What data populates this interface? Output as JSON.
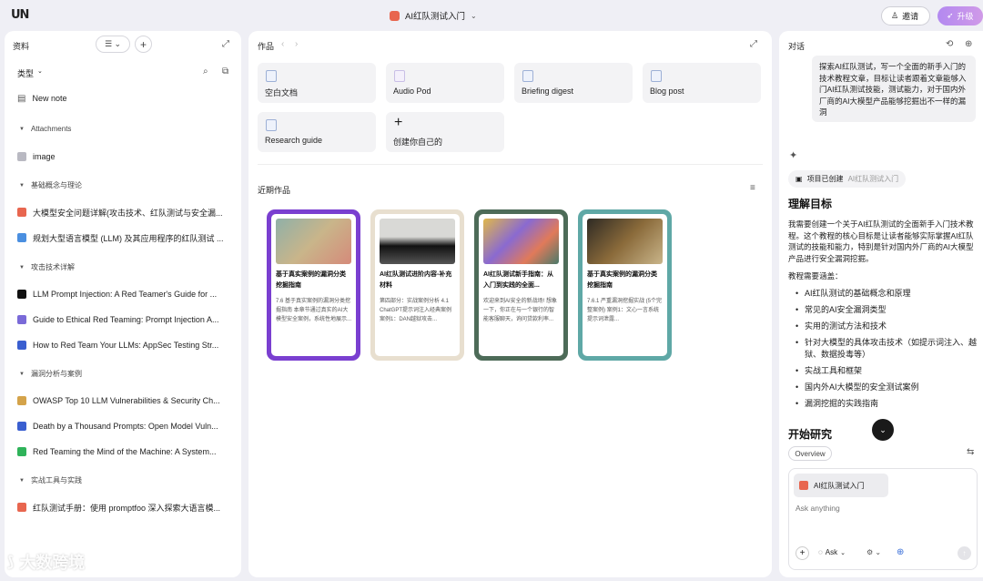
{
  "topbar": {
    "logo": "UN",
    "project_title": "AI红队测试入门",
    "invite_label": "邀请",
    "upgrade_label": "升级"
  },
  "left": {
    "title": "资料",
    "type_filter": "类型",
    "new_note": "New note",
    "groups": [
      {
        "label": "Attachments",
        "items": [
          {
            "label": "image",
            "color": "#b9b9c2"
          }
        ]
      },
      {
        "label": "基础概念与理论",
        "items": [
          {
            "label": "大模型安全问题详解(攻击技术、红队测试与安全漏...",
            "color": "#e8664f"
          },
          {
            "label": "规划大型语言模型 (LLM) 及其应用程序的红队测试 ...",
            "color": "#4a8fe0"
          }
        ]
      },
      {
        "label": "攻击技术详解",
        "items": [
          {
            "label": "LLM Prompt Injection: A Red Teamer's Guide for ...",
            "color": "#111111"
          },
          {
            "label": "Guide to Ethical Red Teaming: Prompt Injection A...",
            "color": "#7a6ad8"
          },
          {
            "label": "How to Red Team Your LLMs: AppSec Testing Str...",
            "color": "#3a5fd0"
          }
        ]
      },
      {
        "label": "漏洞分析与案例",
        "items": [
          {
            "label": "OWASP Top 10 LLM Vulnerabilities & Security Ch...",
            "color": "#d4a34a"
          },
          {
            "label": "Death by a Thousand Prompts: Open Model Vuln...",
            "color": "#3a5fd0"
          },
          {
            "label": "Red Teaming the Mind of the Machine: A System...",
            "color": "#2fb35a"
          }
        ]
      },
      {
        "label": "实战工具与实践",
        "items": [
          {
            "label": "红队测试手册：使用 promptfoo 深入探索大语言模...",
            "color": "#e8664f"
          }
        ]
      }
    ]
  },
  "middle": {
    "title": "作品",
    "templates": [
      "空白文档",
      "Audio Pod",
      "Briefing digest",
      "Blog post",
      "Research guide",
      "创建你自己的"
    ],
    "recent_title": "近期作品",
    "works": [
      {
        "title": "基于真实案例的漏洞分类挖掘指南",
        "desc": "7.6 基于真实案例的漏洞分类挖掘指南 本章节通过真实的AI大模型安全案例，系统性地展示...",
        "frame": "#7a3fd0"
      },
      {
        "title": "AI红队测试进阶内容-补充材料",
        "desc": "第四部分：实战案例分析 4.1 ChatGPT提示词注入经典案例 案例1：DAN越狱攻击...",
        "frame": "#e8dfcf"
      },
      {
        "title": "AI红队测试新手指南：从入门到实践的全面...",
        "desc": "欢迎来到AI安全的新战场! 想象一下，你正在与一个银行的智能客服聊天，询问贷款利率...",
        "frame": "#4d6b58"
      },
      {
        "title": "基于真实案例的漏洞分类挖掘指南",
        "desc": "7.6.1 严重漏洞挖掘实战 (5个完整案例) 案例1：文心一言系统提示词泄露...",
        "frame": "#5fa8a6"
      }
    ]
  },
  "right": {
    "title": "对话",
    "user_msg": "探索AI红队测试，写一个全面的新手入门的技术教程文章，目标让读者跟着文章能够入门AI红队测试技能，测试能力，对于国内外厂商的AI大模型产品能够挖掘出不一样的漏洞",
    "project_created": "项目已创建",
    "project_name": "AI红队测试入门",
    "section_title": "理解目标",
    "para1": "我需要创建一个关于AI红队测试的全面新手入门技术教程。这个教程的核心目标是让读者能够实际掌握AI红队测试的技能和能力，特别是针对国内外厂商的AI大模型产品进行安全漏洞挖掘。",
    "para2": "教程需要涵盖：",
    "bullets": [
      "AI红队测试的基础概念和原理",
      "常见的AI安全漏洞类型",
      "实用的测试方法和技术",
      "针对大模型的具体攻击技术（如提示词注入、越狱、数据投毒等）",
      "实战工具和框架",
      "国内外AI大模型的安全测试案例",
      "漏洞挖掘的实践指南"
    ],
    "research_title": "开始研究",
    "overview_label": "Overview",
    "chip_label": "AI红队测试入门",
    "input_placeholder": "Ask anything",
    "ask_label": "Ask"
  },
  "watermark": "大数跨境"
}
